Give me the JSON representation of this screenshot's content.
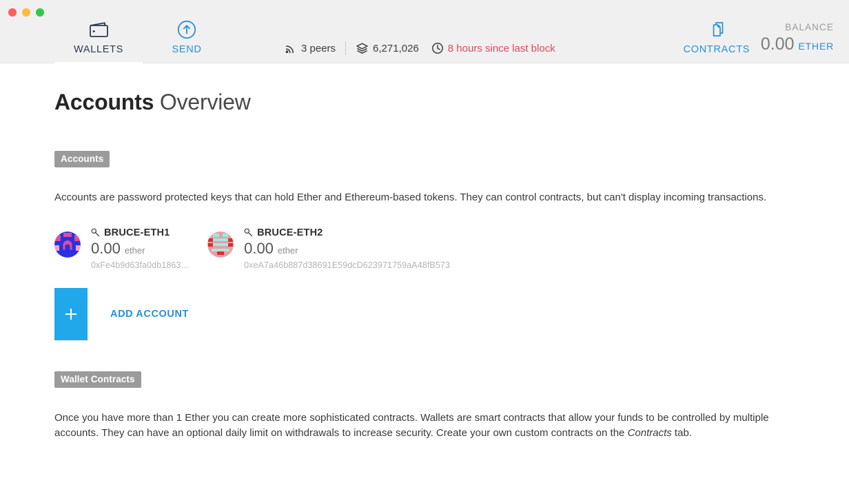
{
  "window": {
    "traffic_lights": [
      {
        "name": "close",
        "color": "#fc605c"
      },
      {
        "name": "minimize",
        "color": "#fdbc40"
      },
      {
        "name": "zoom",
        "color": "#34c84a"
      }
    ]
  },
  "nav": {
    "tabs": [
      {
        "id": "wallets",
        "label": "WALLETS",
        "icon": "wallet-icon",
        "active": true
      },
      {
        "id": "send",
        "label": "SEND",
        "icon": "send-arrow-icon",
        "active": false
      }
    ],
    "contracts": {
      "label": "CONTRACTS",
      "icon": "documents-icon"
    }
  },
  "status": {
    "peers": "3 peers",
    "peers_icon": "peers-signal-icon",
    "block_number": "6,271,026",
    "block_icon": "blocks-stack-icon",
    "sync_icon": "clock-icon",
    "sync_text": "8 hours since last block",
    "sync_color": "#e0485c"
  },
  "balance": {
    "label": "BALANCE",
    "amount": "0.00",
    "unit": "ETHER",
    "unit_color": "#2a8fd4"
  },
  "page": {
    "title_strong": "Accounts",
    "title_light": "Overview"
  },
  "accounts_section": {
    "tag": "Accounts",
    "description": "Accounts are password protected keys that can hold Ether and Ethereum-based tokens. They can control contracts, but can't display incoming transactions.",
    "accounts": [
      {
        "name": "BRUCE-ETH1",
        "balance": "0.00",
        "unit": "ether",
        "address": "0xFe4b9d63fa0db1863…",
        "identicon_colors": [
          "#2b31e0",
          "#d94f9c",
          "#f0a0c8"
        ]
      },
      {
        "name": "BRUCE-ETH2",
        "balance": "0.00",
        "unit": "ether",
        "address": "0xeA7a46b887d38691E59dcD623971759aA48fB573",
        "identicon_colors": [
          "#e4a0a6",
          "#a8e6dc",
          "#e02b2b"
        ]
      }
    ],
    "add_account": {
      "label": "ADD ACCOUNT",
      "icon": "plus-icon",
      "color": "#21a8ea"
    }
  },
  "wallet_contracts_section": {
    "tag": "Wallet Contracts",
    "line1": "Once you have more than 1 Ether you can create more sophisticated contracts. Wallets are smart contracts that allow your funds to be controlled by multiple accounts.",
    "line2_a": "They can have an optional daily limit on withdrawals to increase security. Create your own custom contracts on the ",
    "line2_em": "Contracts",
    "line2_b": " tab."
  }
}
